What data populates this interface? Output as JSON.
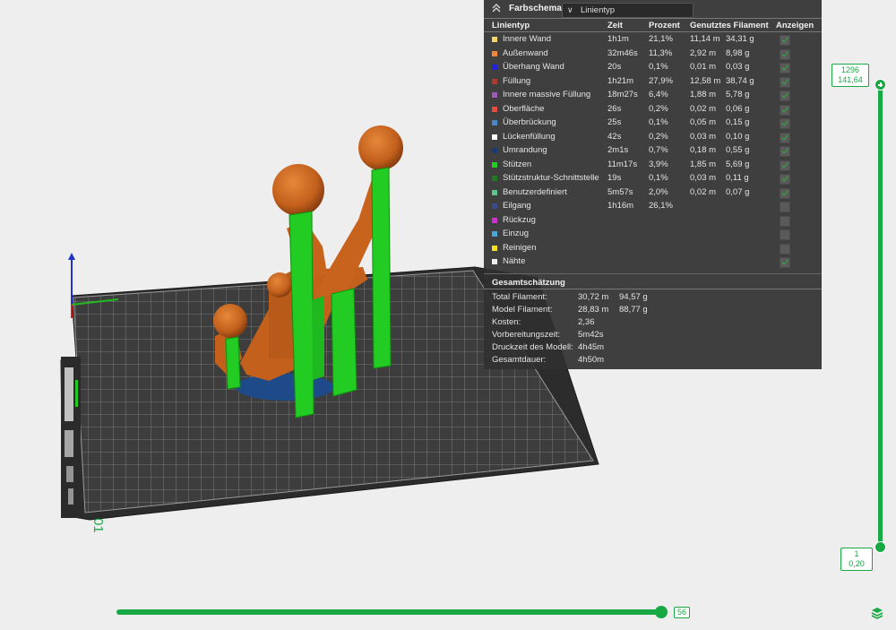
{
  "panel": {
    "title": "Farbschema",
    "view_select": "Linientyp",
    "columns": {
      "type": "Linientyp",
      "time": "Zeit",
      "percent": "Prozent",
      "filament": "Genutztes Filament",
      "show": "Anzeigen"
    },
    "rows": [
      {
        "name": "Innere Wand",
        "color": "#f5d66b",
        "time": "1h1m",
        "percent": "21,1%",
        "len": "11,14 m",
        "weight": "34,31 g",
        "show": true
      },
      {
        "name": "Außenwand",
        "color": "#f0883a",
        "time": "32m46s",
        "percent": "11,3%",
        "len": "2,92 m",
        "weight": "8,98 g",
        "show": true
      },
      {
        "name": "Überhang Wand",
        "color": "#2222dd",
        "time": "20s",
        "percent": "0,1%",
        "len": "0,01 m",
        "weight": "0,03 g",
        "show": true
      },
      {
        "name": "Füllung",
        "color": "#b03a2e",
        "time": "1h21m",
        "percent": "27,9%",
        "len": "12,58 m",
        "weight": "38,74 g",
        "show": true
      },
      {
        "name": "Innere massive Füllung",
        "color": "#9b59b6",
        "time": "18m27s",
        "percent": "6,4%",
        "len": "1,88 m",
        "weight": "5,78 g",
        "show": true
      },
      {
        "name": "Oberfläche",
        "color": "#e74c3c",
        "time": "26s",
        "percent": "0,2%",
        "len": "0,02 m",
        "weight": "0,06 g",
        "show": true
      },
      {
        "name": "Überbrückung",
        "color": "#4a86c8",
        "time": "25s",
        "percent": "0,1%",
        "len": "0,05 m",
        "weight": "0,15 g",
        "show": true
      },
      {
        "name": "Lückenfüllung",
        "color": "#ffffff",
        "time": "42s",
        "percent": "0,2%",
        "len": "0,03 m",
        "weight": "0,10 g",
        "show": true
      },
      {
        "name": "Umrandung",
        "color": "#1a3c6e",
        "time": "2m1s",
        "percent": "0,7%",
        "len": "0,18 m",
        "weight": "0,55 g",
        "show": true
      },
      {
        "name": "Stützen",
        "color": "#22cc22",
        "time": "11m17s",
        "percent": "3,9%",
        "len": "1,85 m",
        "weight": "5,69 g",
        "show": true
      },
      {
        "name": "Stützstruktur-Schnittstelle",
        "color": "#1e7a1e",
        "time": "19s",
        "percent": "0,1%",
        "len": "0,03 m",
        "weight": "0,11 g",
        "show": true
      },
      {
        "name": "Benutzerdefiniert",
        "color": "#5ec08a",
        "time": "5m57s",
        "percent": "2,0%",
        "len": "0,02 m",
        "weight": "0,07 g",
        "show": true
      },
      {
        "name": "Eilgang",
        "color": "#3a4a8a",
        "time": "1h16m",
        "percent": "26,1%",
        "len": "",
        "weight": "",
        "show": false
      },
      {
        "name": "Rückzug",
        "color": "#cc33cc",
        "time": "",
        "percent": "",
        "len": "",
        "weight": "",
        "show": false
      },
      {
        "name": "Einzug",
        "color": "#4aa8d8",
        "time": "",
        "percent": "",
        "len": "",
        "weight": "",
        "show": false
      },
      {
        "name": "Reinigen",
        "color": "#f5e020",
        "time": "",
        "percent": "",
        "len": "",
        "weight": "",
        "show": false
      },
      {
        "name": "Nähte",
        "color": "#eeeeee",
        "time": "",
        "percent": "",
        "len": "",
        "weight": "",
        "show": true
      }
    ],
    "summary_title": "Gesamtschätzung",
    "summary": [
      {
        "label": "Total Filament:",
        "v1": "30,72 m",
        "v2": "94,57 g"
      },
      {
        "label": "Model Filament:",
        "v1": "28,83 m",
        "v2": "88,77 g"
      },
      {
        "label": "Kosten:",
        "v1": "2,36",
        "v2": ""
      },
      {
        "label": "Vorbereitungszeit:",
        "v1": "5m42s",
        "v2": ""
      },
      {
        "label": "Druckzeit des Modell:",
        "v1": "4h45m",
        "v2": ""
      },
      {
        "label": "Gesamtdauer:",
        "v1": "4h50m",
        "v2": ""
      }
    ]
  },
  "layer_slider": {
    "top_layer": "1296",
    "top_height": "141,64",
    "bottom_layer": "1",
    "bottom_height": "0,20"
  },
  "move_slider": {
    "value": "56",
    "progress": 0.98
  },
  "plate": {
    "number": "01"
  },
  "colors": {
    "accent": "#18a944",
    "model": "#c8611e",
    "support": "#22cc22",
    "plate": "#3a3a3a"
  }
}
